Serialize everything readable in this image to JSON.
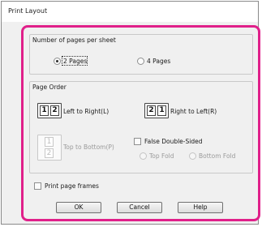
{
  "window": {
    "title": "Print Layout"
  },
  "pages_group": {
    "label": "Number of pages per sheet",
    "option_2": "2 Pages",
    "option_4": "4 Pages",
    "selected": "2 Pages"
  },
  "order_group": {
    "label": "Page Order",
    "ltr_label": "Left to Right(L)",
    "rtl_label": "Right to Left(R)",
    "ttb_label": "Top to Bottom(P)",
    "ltr_icon": [
      "1",
      "2"
    ],
    "rtl_icon": [
      "2",
      "1"
    ],
    "ttb_icon": [
      "1",
      "2"
    ],
    "false_double_sided": "False Double-Sided",
    "top_fold": "Top Fold",
    "bottom_fold": "Bottom Fold"
  },
  "print_frames": {
    "label": "Print page frames"
  },
  "buttons": {
    "ok": "OK",
    "cancel": "Cancel",
    "help": "Help"
  },
  "colors": {
    "highlight": "#e0208a",
    "dialog_bg": "#f0f0f0"
  }
}
